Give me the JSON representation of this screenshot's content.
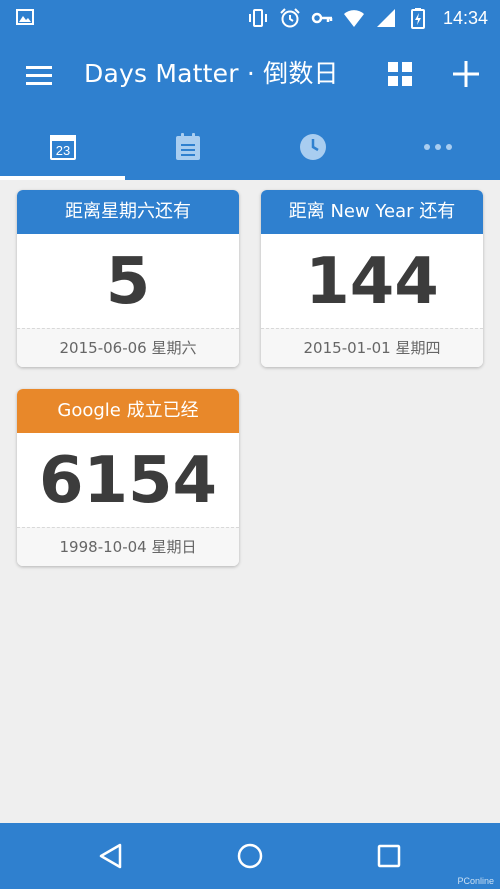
{
  "status_bar": {
    "time": "14:34",
    "icons": [
      "image-icon",
      "vibrate-icon",
      "alarm-icon",
      "key-icon",
      "wifi-icon",
      "signal-icon",
      "battery-icon"
    ]
  },
  "app_bar": {
    "title": "Days Matter · 倒数日",
    "icons": [
      "menu-icon",
      "grid-view-icon",
      "add-icon"
    ]
  },
  "tabs": [
    {
      "name": "calendar-tab",
      "badge": "23",
      "icon": "calendar-icon",
      "selected": true
    },
    {
      "name": "notes-tab",
      "icon": "notepad-icon",
      "selected": false
    },
    {
      "name": "history-tab",
      "icon": "clock-icon",
      "selected": false
    },
    {
      "name": "more-tab",
      "icon": "more-icon",
      "selected": false
    }
  ],
  "cards": [
    {
      "title": "距离星期六还有",
      "number": "5",
      "date": "2015-06-06 星期六",
      "color": "#2f80cf"
    },
    {
      "title": "距离 New Year 还有",
      "number": "144",
      "date": "2015-01-01 星期四",
      "color": "#2f80cf"
    },
    {
      "title": "Google 成立已经",
      "number": "6154",
      "date": "1998-10-04 星期日",
      "color": "#e8882a"
    }
  ],
  "nav_bar": {
    "icons": [
      "back-icon",
      "home-icon",
      "recents-icon"
    ]
  },
  "watermark": "PConline",
  "colors": {
    "primary": "#2f80cf",
    "accent_orange": "#e8882a",
    "background": "#efefef"
  }
}
